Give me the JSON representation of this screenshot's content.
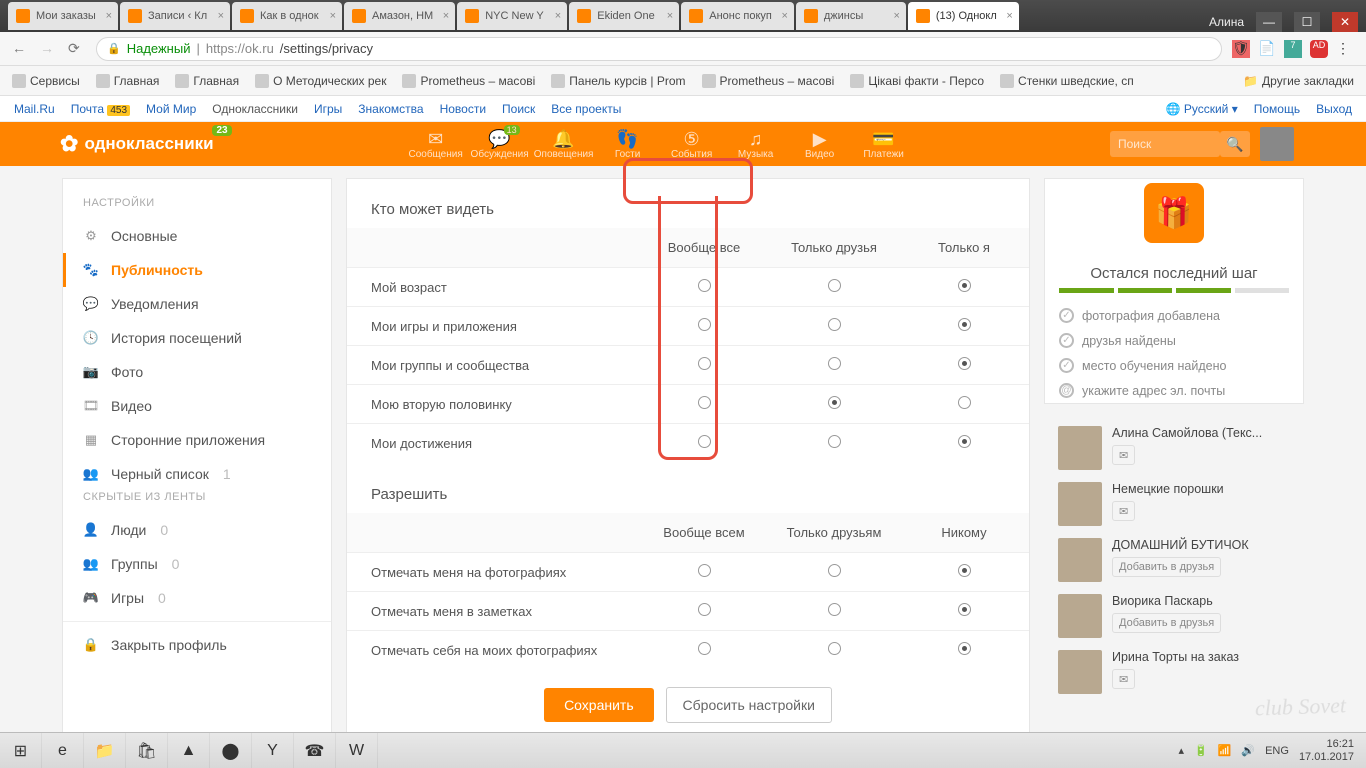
{
  "chrome": {
    "tabs": [
      {
        "label": "Мои заказы"
      },
      {
        "label": "Записи ‹ Кл"
      },
      {
        "label": "Как в однок"
      },
      {
        "label": "Амазон, HM"
      },
      {
        "label": "NYC New Y"
      },
      {
        "label": "Ekiden One"
      },
      {
        "label": "Анонс покуп"
      },
      {
        "label": "джинсы"
      },
      {
        "label": "(13) Однокл"
      }
    ],
    "user": "Алина",
    "secure": "Надежный",
    "url_host": "https://ok.ru",
    "url_path": "/settings/privacy"
  },
  "bookmarks": {
    "items": [
      "Сервисы",
      "Главная",
      "Главная",
      "О Методических рек",
      "Prometheus – масові",
      "Панель курсів | Prom",
      "Prometheus – масові",
      "Цікаві факти - Персо",
      "Стенки шведские, сп"
    ],
    "more": "Другие закладки"
  },
  "mailru": {
    "left": [
      "Mail.Ru",
      "Почта",
      "Мой Мир",
      "Одноклассники",
      "Игры",
      "Знакомства",
      "Новости",
      "Поиск",
      "Все проекты"
    ],
    "badge": "453",
    "right": [
      "Русский",
      "Помощь",
      "Выход"
    ]
  },
  "ok": {
    "brand": "одноклассники",
    "brand_badge": "23",
    "nav": [
      {
        "label": "Сообщения",
        "icon": "✉"
      },
      {
        "label": "Обсуждения",
        "icon": "💬",
        "badge": "13"
      },
      {
        "label": "Оповещения",
        "icon": "🔔"
      },
      {
        "label": "Гости",
        "icon": "👣"
      },
      {
        "label": "События",
        "icon": "⑤"
      },
      {
        "label": "Музыка",
        "icon": "♫"
      },
      {
        "label": "Видео",
        "icon": "▶"
      },
      {
        "label": "Платежи",
        "icon": "💳"
      }
    ],
    "search_ph": "Поиск"
  },
  "sidebar": {
    "h1": "НАСТРОЙКИ",
    "items1": [
      {
        "icon": "⚙",
        "label": "Основные"
      },
      {
        "icon": "🐾",
        "label": "Публичность",
        "active": true
      },
      {
        "icon": "💬",
        "label": "Уведомления"
      },
      {
        "icon": "🕓",
        "label": "История посещений"
      },
      {
        "icon": "📷",
        "label": "Фото"
      },
      {
        "icon": "🎞",
        "label": "Видео"
      },
      {
        "icon": "▦",
        "label": "Сторонние приложения"
      },
      {
        "icon": "👥",
        "label": "Черный список",
        "count": "1"
      }
    ],
    "h2": "СКРЫТЫЕ ИЗ ЛЕНТЫ",
    "items2": [
      {
        "icon": "👤",
        "label": "Люди",
        "count": "0"
      },
      {
        "icon": "👥",
        "label": "Группы",
        "count": "0"
      },
      {
        "icon": "🎮",
        "label": "Игры",
        "count": "0"
      }
    ],
    "close": {
      "icon": "🔒",
      "label": "Закрыть профиль"
    }
  },
  "main": {
    "h1": "Кто может видеть",
    "cols1": [
      "Вообще все",
      "Только друзья",
      "Только я"
    ],
    "rows1": [
      {
        "label": "Мой возраст",
        "sel": 2
      },
      {
        "label": "Мои игры и приложения",
        "sel": 2
      },
      {
        "label": "Мои группы и сообщества",
        "sel": 2
      },
      {
        "label": "Мою вторую половинку",
        "sel": 1
      },
      {
        "label": "Мои достижения",
        "sel": 2
      }
    ],
    "h2": "Разрешить",
    "cols2": [
      "Вообще всем",
      "Только друзьям",
      "Никому"
    ],
    "rows2": [
      {
        "label": "Отмечать меня на фотографиях",
        "sel": 2
      },
      {
        "label": "Отмечать меня в заметках",
        "sel": 2
      },
      {
        "label": "Отмечать себя на моих фотографиях",
        "sel": 2
      }
    ],
    "save": "Сохранить",
    "reset": "Сбросить настройки"
  },
  "right": {
    "step": "Остался последний шаг",
    "checks": [
      {
        "label": "фотография добавлена",
        "done": true
      },
      {
        "label": "друзья найдены",
        "done": true
      },
      {
        "label": "место обучения найдено",
        "done": true
      },
      {
        "label": "укажите адрес эл. почты",
        "done": false
      }
    ],
    "friends": [
      {
        "name": "Алина Самойлова (Текс...",
        "act": "msg"
      },
      {
        "name": "Немецкие порошки",
        "act": "msg"
      },
      {
        "name": "ДОМАШНИЙ БУТИЧОК",
        "act": "add",
        "add": "Добавить в друзья"
      },
      {
        "name": "Виорика Паскарь",
        "act": "add",
        "add": "Добавить в друзья"
      },
      {
        "name": "Ирина Торты на заказ",
        "act": "msg"
      }
    ]
  },
  "taskbar": {
    "lang": "ENG",
    "time": "16:21",
    "date": "17.01.2017"
  },
  "watermark": "club Sovet"
}
